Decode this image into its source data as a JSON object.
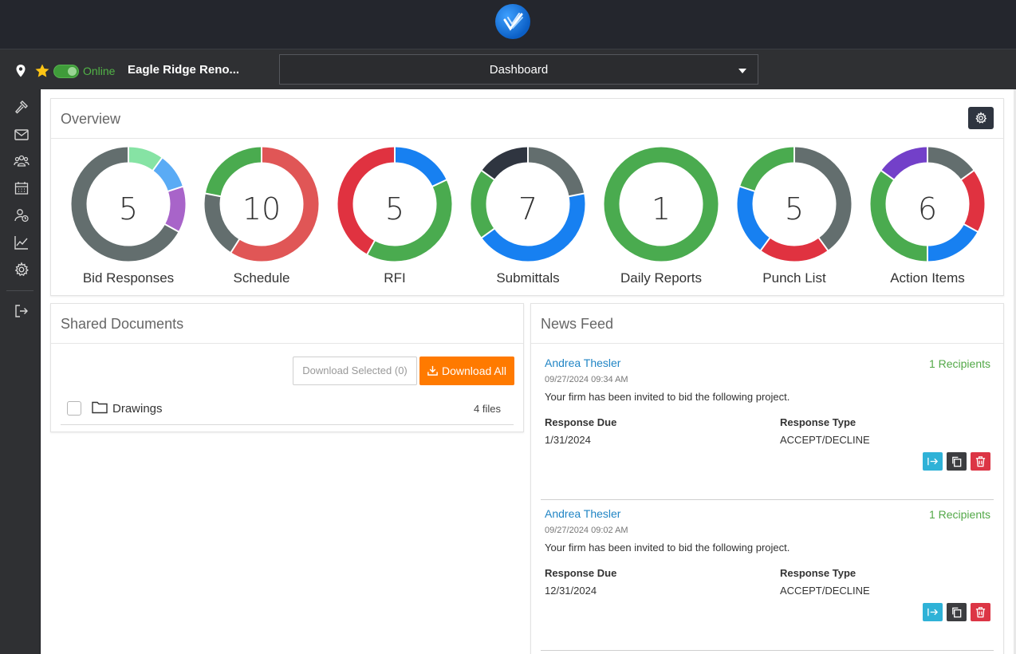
{
  "header": {
    "logo_icon": "checkmark-logo-icon"
  },
  "project_bar": {
    "location_icon": "map-pin-icon",
    "favorite_icon": "star-icon",
    "status": "Online",
    "project_name": "Eagle Ridge Reno...",
    "view_selector": "Dashboard"
  },
  "sidebar": {
    "items": [
      {
        "icon": "hammer-icon"
      },
      {
        "icon": "mail-icon"
      },
      {
        "icon": "users-icon"
      },
      {
        "icon": "calendar-icon"
      },
      {
        "icon": "user-clock-icon"
      },
      {
        "icon": "chart-line-icon"
      },
      {
        "icon": "gear-icon"
      },
      {
        "icon": "logout-icon"
      }
    ]
  },
  "overview": {
    "title": "Overview",
    "donuts": [
      {
        "label": "Bid Responses",
        "value": "5",
        "segments": [
          {
            "fraction": 0.1,
            "color": "#86e3a4"
          },
          {
            "fraction": 0.1,
            "color": "#5aabf5"
          },
          {
            "fraction": 0.13,
            "color": "#a864c9"
          },
          {
            "fraction": 0.67,
            "color": "#636e6e"
          }
        ]
      },
      {
        "label": "Schedule",
        "value": "10",
        "segments": [
          {
            "fraction": 0.59,
            "color": "#e05656"
          },
          {
            "fraction": 0.19,
            "color": "#636e6e"
          },
          {
            "fraction": 0.22,
            "color": "#4aab4f"
          }
        ]
      },
      {
        "label": "RFI",
        "value": "5",
        "segments": [
          {
            "fraction": 0.18,
            "color": "#1780f1"
          },
          {
            "fraction": 0.4,
            "color": "#4aab4f"
          },
          {
            "fraction": 0.42,
            "color": "#e03240"
          }
        ]
      },
      {
        "label": "Submittals",
        "value": "7",
        "segments": [
          {
            "fraction": 0.22,
            "color": "#636e6e"
          },
          {
            "fraction": 0.43,
            "color": "#1780f1"
          },
          {
            "fraction": 0.2,
            "color": "#4aab4f"
          },
          {
            "fraction": 0.15,
            "color": "#2f3540"
          }
        ]
      },
      {
        "label": "Daily Reports",
        "value": "1",
        "segments": [
          {
            "fraction": 1.0,
            "color": "#4aab4f"
          }
        ]
      },
      {
        "label": "Punch List",
        "value": "5",
        "segments": [
          {
            "fraction": 0.4,
            "color": "#636e6e"
          },
          {
            "fraction": 0.2,
            "color": "#e03240"
          },
          {
            "fraction": 0.2,
            "color": "#1780f1"
          },
          {
            "fraction": 0.2,
            "color": "#4aab4f"
          }
        ]
      },
      {
        "label": "Action Items",
        "value": "6",
        "segments": [
          {
            "fraction": 0.15,
            "color": "#636e6e"
          },
          {
            "fraction": 0.18,
            "color": "#e03240"
          },
          {
            "fraction": 0.17,
            "color": "#1780f1"
          },
          {
            "fraction": 0.35,
            "color": "#4aab4f"
          },
          {
            "fraction": 0.15,
            "color": "#7340c9"
          }
        ]
      }
    ]
  },
  "shared_documents": {
    "title": "Shared Documents",
    "download_selected": "Download Selected (0)",
    "download_all": "Download All",
    "rows": [
      {
        "name": "Drawings",
        "count": "4 files"
      }
    ]
  },
  "news_feed": {
    "title": "News Feed",
    "labels": {
      "response_due": "Response Due",
      "response_type": "Response Type"
    },
    "items": [
      {
        "author": "Andrea Thesler",
        "recipients": "1 Recipients",
        "date": "09/27/2024 09:34 AM",
        "message": "Your firm has been invited to bid the following project.",
        "response_due": "1/31/2024",
        "response_type": "ACCEPT/DECLINE"
      },
      {
        "author": "Andrea Thesler",
        "recipients": "1 Recipients",
        "date": "09/27/2024 09:02 AM",
        "message": "Your firm has been invited to bid the following project.",
        "response_due": "12/31/2024",
        "response_type": "ACCEPT/DECLINE"
      }
    ]
  }
}
